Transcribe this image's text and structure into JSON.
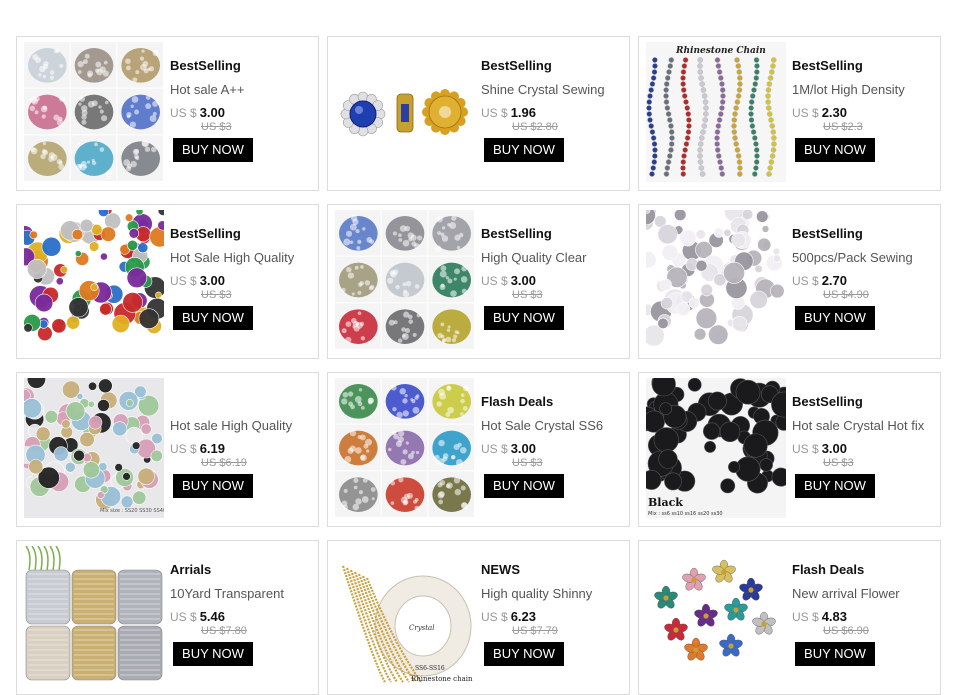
{
  "products": [
    {
      "tag": "BestSelling",
      "title": "Hot sale A++",
      "currency": "US $",
      "price": "3.00",
      "old_price": "US $3",
      "button": "BUY NOW",
      "thumb": {
        "type": "grid",
        "colors": [
          "#c9cfd8",
          "#9a8f86",
          "#b39a6a",
          "#c96b8e",
          "#6a6a6a",
          "#4f6fc9",
          "#b4a46e",
          "#4fa8c9",
          "#7b7f86"
        ]
      }
    },
    {
      "tag": "BestSelling",
      "title": "Shine Crystal Sewing",
      "currency": "US $",
      "price": "1.96",
      "old_price": "US $2.80",
      "button": "BUY NOW",
      "thumb": {
        "type": "flower-sew"
      }
    },
    {
      "tag": "BestSelling",
      "title": "1M/lot High Density",
      "currency": "US $",
      "price": "2.30",
      "old_price": "US $2.3",
      "button": "BUY NOW",
      "thumb": {
        "type": "chains",
        "label": "Rhinestone Chain",
        "colors": [
          "#2a3f8f",
          "#6a6f7a",
          "#b22a2a",
          "#c9c9d2",
          "#8a6a9a",
          "#c9a53a",
          "#3a7f6a",
          "#d2c43a"
        ]
      }
    },
    {
      "tag": "BestSelling",
      "title": "Hot Sale High Quality",
      "currency": "US $",
      "price": "3.00",
      "old_price": "US $3",
      "button": "BUY NOW",
      "thumb": {
        "type": "scatter",
        "colors": [
          "#c92a2a",
          "#2a6fc9",
          "#2a9a4a",
          "#e0b020",
          "#7a2a9a",
          "#e07a20",
          "#333333",
          "#c0c0c0"
        ]
      }
    },
    {
      "tag": "BestSelling",
      "title": "High Quality Clear",
      "currency": "US $",
      "price": "3.00",
      "old_price": "US $3",
      "button": "BUY NOW",
      "thumb": {
        "type": "grid",
        "colors": [
          "#5a7ac9",
          "#8a8a90",
          "#9a9aa2",
          "#a09a7a",
          "#c0c4cc",
          "#2a7a5a",
          "#c92a3a",
          "#6a6a6e",
          "#b4a42a"
        ]
      }
    },
    {
      "tag": "BestSelling",
      "title": "500pcs/Pack Sewing",
      "currency": "US $",
      "price": "2.70",
      "old_price": "US $4.90",
      "button": "BUY NOW",
      "thumb": {
        "type": "scatter",
        "colors": [
          "#d8d4dc",
          "#b8b4bc",
          "#e8e6ea",
          "#9a96a0",
          "#f2f0f4"
        ]
      }
    },
    {
      "tag": "",
      "title": "Hot sale High Quality",
      "currency": "US $",
      "price": "6.19",
      "old_price": "US $6.19",
      "button": "BUY NOW",
      "thumb": {
        "type": "scatter-dark",
        "caption": "Mix size : SS20 SS30 SS40",
        "colors": [
          "#222222",
          "#c8b07a",
          "#9ac0d8",
          "#d8a0b8",
          "#a0c89a",
          "#eaeaea"
        ]
      }
    },
    {
      "tag": "Flash Deals",
      "title": "Hot Sale Crystal SS6",
      "currency": "US $",
      "price": "3.00",
      "old_price": "US $3",
      "button": "BUY NOW",
      "thumb": {
        "type": "grid",
        "colors": [
          "#3a8a4a",
          "#3a4ac9",
          "#c9c93a",
          "#c9702a",
          "#8a6aaa",
          "#2a9ac9",
          "#8a8a8a",
          "#c93a2a",
          "#6a6a3a"
        ]
      }
    },
    {
      "tag": "BestSelling",
      "title": "Hot sale Crystal Hot fix",
      "currency": "US $",
      "price": "3.00",
      "old_price": "US $3",
      "button": "BUY NOW",
      "thumb": {
        "type": "black",
        "label": "Black",
        "caption": "Mix : ss6 ss10 ss16 ss20 ss30"
      }
    },
    {
      "tag": "Arrials",
      "title": "10Yard Transparent",
      "currency": "US $",
      "price": "5.46",
      "old_price": "US $7.80",
      "button": "BUY NOW",
      "thumb": {
        "type": "rolls",
        "colors": [
          "#c8ccd2",
          "#c9b070",
          "#b0b4ba",
          "#d8d0c0",
          "#c9b070",
          "#a8acb2"
        ]
      }
    },
    {
      "tag": "NEWS",
      "title": "High quality Shinny",
      "currency": "US $",
      "price": "6.23",
      "old_price": "US $7.79",
      "button": "BUY NOW",
      "thumb": {
        "type": "spool",
        "label": "Crystal",
        "caption1": "SS6-SS16",
        "caption2": "Rhinestone chain"
      }
    },
    {
      "tag": "Flash Deals",
      "title": "New arrival Flower",
      "currency": "US $",
      "price": "4.83",
      "old_price": "US $6.90",
      "button": "BUY NOW",
      "thumb": {
        "type": "flowers",
        "colors": [
          "#2a8a7a",
          "#e0a0b0",
          "#d8c060",
          "#2a3a9a",
          "#c92a3a",
          "#6a2a8a",
          "#2a9a9a",
          "#c0c0c0",
          "#e07a2a",
          "#3a6ac9"
        ]
      }
    }
  ]
}
